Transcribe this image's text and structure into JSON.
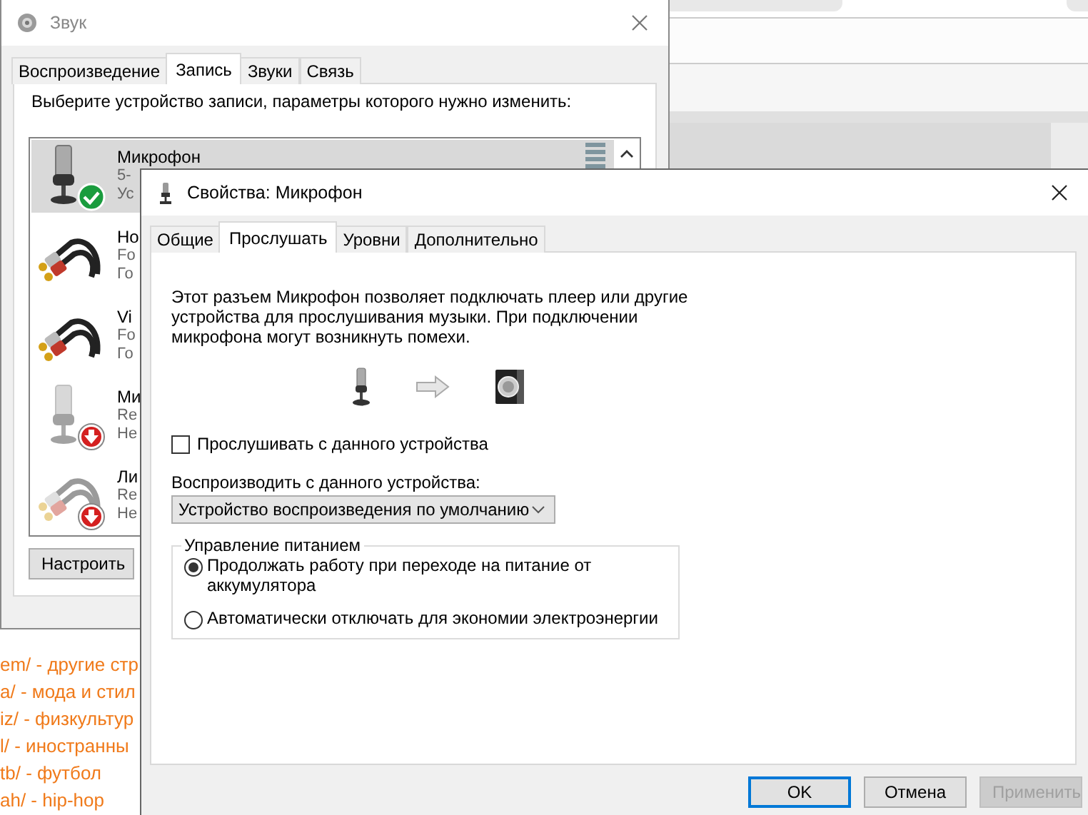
{
  "browser_links": [
    "em/ - другие стр",
    "a/ - мода и стил",
    "iz/ - физкультур",
    "l/ - иностранны",
    "tb/ - футбол",
    "ah/ - hip-hop"
  ],
  "sound_window": {
    "title": "Звук",
    "tabs": [
      {
        "label": "Воспроизведение",
        "selected": false
      },
      {
        "label": "Запись",
        "selected": true
      },
      {
        "label": "Звуки",
        "selected": false
      },
      {
        "label": "Связь",
        "selected": false
      }
    ],
    "instruction": "Выберите устройство записи, параметры которого нужно изменить:",
    "devices": [
      {
        "name": "Микрофон",
        "line_1": "5-",
        "line_2": "Ус",
        "kind": "mic",
        "is_default": true,
        "disabled": false,
        "selected": true
      },
      {
        "name": "Но",
        "line_1": "Fo",
        "line_2": "Го",
        "kind": "cable",
        "is_default": false,
        "disabled": false,
        "selected": false
      },
      {
        "name": "Vi",
        "line_1": "Fo",
        "line_2": "Го",
        "kind": "cable",
        "is_default": false,
        "disabled": false,
        "selected": false
      },
      {
        "name": "Ми",
        "line_1": "Re",
        "line_2": "Не",
        "kind": "mic",
        "is_default": false,
        "disabled": true,
        "selected": false
      },
      {
        "name": "Ли",
        "line_1": "Re",
        "line_2": "Не",
        "kind": "cable",
        "is_default": false,
        "disabled": true,
        "selected": false
      }
    ],
    "configure_button": "Настроить"
  },
  "properties_window": {
    "title": "Свойства: Микрофон",
    "tabs": [
      {
        "label": "Общие",
        "selected": false
      },
      {
        "label": "Прослушать",
        "selected": true
      },
      {
        "label": "Уровни",
        "selected": false
      },
      {
        "label": "Дополнительно",
        "selected": false
      }
    ],
    "description": "Этот разъем Микрофон позволяет подключать плеер или другие устройства для прослушивания музыки. При подключении микрофона могут возникнуть помехи.",
    "listen_checkbox": {
      "label": "Прослушивать с данного устройства",
      "checked": false
    },
    "playback_label": "Воспроизводить с данного устройства:",
    "playback_device": {
      "value": "Устройство воспроизведения по умолчанию"
    },
    "power_group": {
      "title": "Управление питанием",
      "options": [
        {
          "label": "Продолжать работу при переходе на питание от аккумулятора",
          "selected": true
        },
        {
          "label": "Автоматически отключать для экономии электроэнергии",
          "selected": false
        }
      ]
    },
    "buttons": [
      {
        "label": "OK",
        "kind": "default"
      },
      {
        "label": "Отмена",
        "kind": "normal"
      },
      {
        "label": "Применить",
        "kind": "disabled"
      }
    ]
  }
}
